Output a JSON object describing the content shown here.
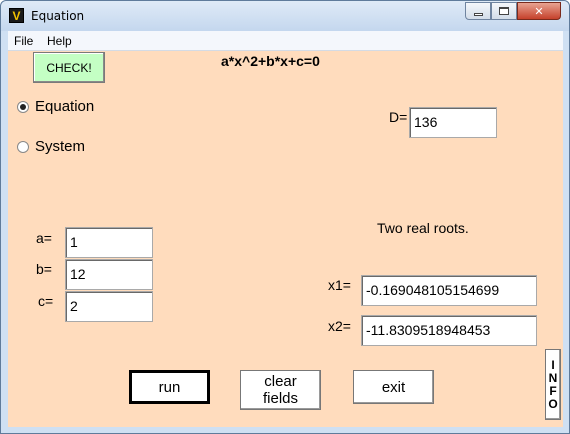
{
  "window": {
    "title": "Equation",
    "app_icon": "V",
    "close_glyph": "✕"
  },
  "menu": {
    "file": "File",
    "help": "Help"
  },
  "toolbar": {
    "check_label": "CHECK!",
    "formula": "a*x^2+b*x+c=0"
  },
  "mode": {
    "equation_label": "Equation",
    "system_label": "System",
    "selected": "Equation"
  },
  "discriminant": {
    "label": "D=",
    "value": "136"
  },
  "coefficients": {
    "a_label": "a=",
    "a_value": "1",
    "b_label": "b=",
    "b_value": "12",
    "c_label": "c=",
    "c_value": "2"
  },
  "result": {
    "message": "Two real roots.",
    "x1_label": "x1=",
    "x1_value": "-0.169048105154699",
    "x2_label": "x2=",
    "x2_value": "-11.8309518948453"
  },
  "buttons": {
    "run": "run",
    "clear_line1": "clear",
    "clear_line2": "fields",
    "exit": "exit",
    "info": [
      "I",
      "N",
      "F",
      "O"
    ]
  }
}
